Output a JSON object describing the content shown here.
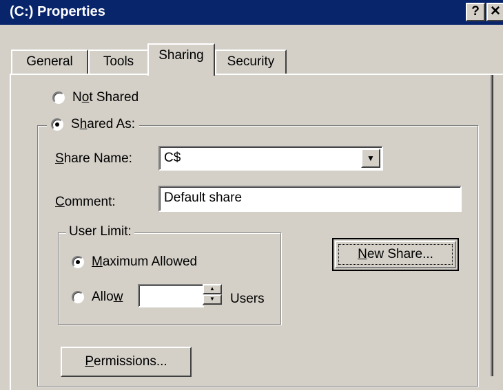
{
  "window": {
    "title": "(C:) Properties",
    "help_label": "?",
    "close_label": "✕"
  },
  "tabs": [
    {
      "label": "General"
    },
    {
      "label": "Tools"
    },
    {
      "label": "Sharing",
      "selected": true
    },
    {
      "label": "Security"
    }
  ],
  "sharing": {
    "not_shared": {
      "prefix": "N",
      "accel": "o",
      "suffix": "t Shared",
      "checked": false
    },
    "shared_as": {
      "prefix": "S",
      "accel": "h",
      "suffix": "ared As:",
      "checked": true
    },
    "share_name": {
      "accel": "S",
      "label_rest": "hare Name:",
      "value": "C$"
    },
    "comment": {
      "accel": "C",
      "label_rest": "omment:",
      "value": "Default share"
    },
    "user_limit": {
      "title": "User Limit:",
      "maximum": {
        "accel": "M",
        "rest": "aximum Allowed",
        "checked": true
      },
      "allow": {
        "prefix": "Allo",
        "accel": "w",
        "checked": false
      },
      "allow_value": "",
      "users_label": "Users"
    },
    "new_share_button": {
      "accel": "N",
      "rest": "ew Share..."
    },
    "permissions_button": {
      "accel": "P",
      "rest": "ermissions..."
    }
  },
  "icons": {
    "dropdown": "▼",
    "spin_up": "▲",
    "spin_down": "▼"
  }
}
